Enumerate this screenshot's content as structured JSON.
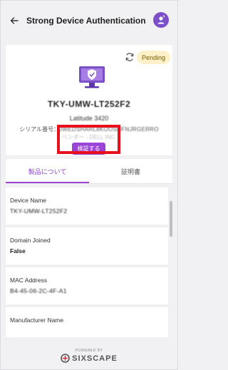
{
  "header": {
    "title": "Strong Device Authentication",
    "back_icon": "arrow-left-icon",
    "avatar_icon": "user-avatar-icon",
    "avatar_color": "#7a4fc7"
  },
  "device": {
    "status_badge": "Pending",
    "refresh_icon": "refresh-icon",
    "device_icon": "monitor-shield-icon",
    "device_id": "TKY-UMW-LT252F2",
    "model": "Latitude 3420",
    "serial_label": "シリアル番号：",
    "serial_value": "JWEDSHARL8KOOSHFNJRGERRO",
    "extra_line": "ベンダー - DELL INC.",
    "verify_button": "検証する",
    "accent_color": "#9a45d8",
    "highlight_color": "#e8101c"
  },
  "tabs": [
    {
      "label": "製品について",
      "active": true
    },
    {
      "label": "証明書",
      "active": false
    }
  ],
  "fields": [
    {
      "label": "Device Name",
      "value": "TKY-UMW-LT252F2"
    },
    {
      "label": "Domain Joined",
      "value": "False"
    },
    {
      "label": "MAC Address",
      "value": "B4-45-06-2C-4F-A1"
    },
    {
      "label": "Manufacturer Name",
      "value": ""
    }
  ],
  "footer": {
    "powered_by": "POWERED BY",
    "brand": "SIXSCAPE",
    "logo_icon": "sixscape-logo-icon"
  }
}
